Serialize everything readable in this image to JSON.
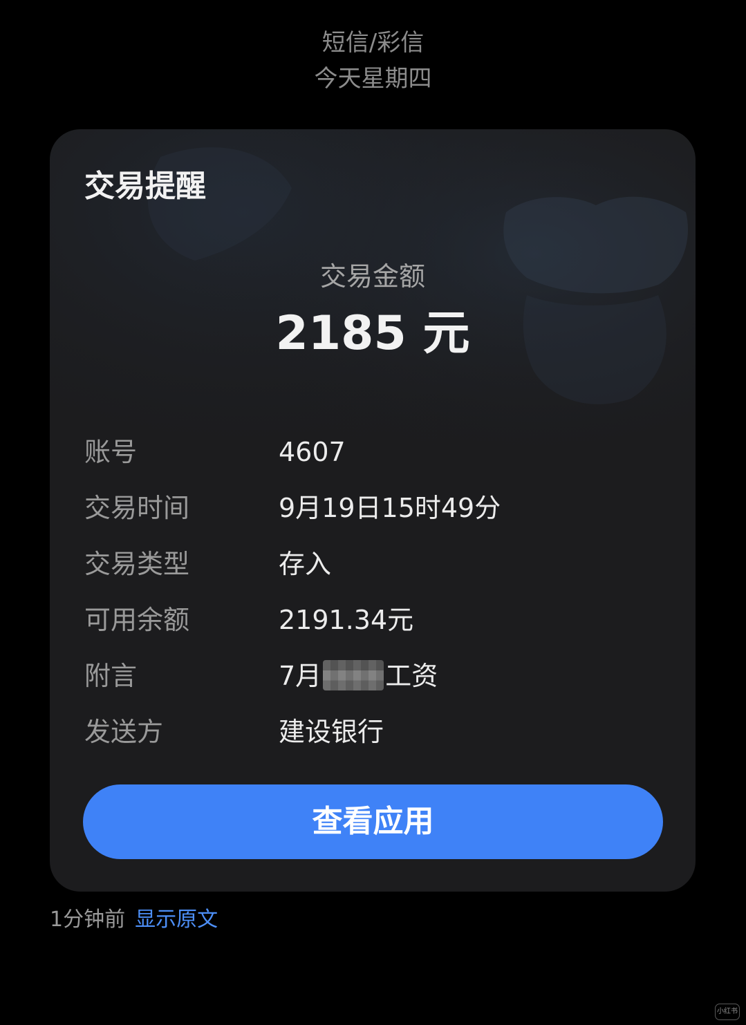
{
  "header": {
    "category": "短信/彩信",
    "date": "今天星期四"
  },
  "card": {
    "title": "交易提醒",
    "amount_label": "交易金额",
    "amount_value": "2185 元",
    "details": [
      {
        "label": "账号",
        "value": "4607"
      },
      {
        "label": "交易时间",
        "value": "9月19日15时49分"
      },
      {
        "label": "交易类型",
        "value": "存入"
      },
      {
        "label": "可用余额",
        "value": "2191.34元"
      },
      {
        "label": "附言",
        "value_prefix": "7月",
        "value_suffix": "工资"
      },
      {
        "label": "发送方",
        "value": "建设银行"
      }
    ],
    "button_label": "查看应用"
  },
  "footer": {
    "time": "1分钟前",
    "link": "显示原文"
  },
  "watermark": {
    "text": "小红书"
  },
  "colors": {
    "background": "#000000",
    "card": "#1c1c1e",
    "accent": "#3f82f7",
    "link": "#4d8ff7"
  }
}
